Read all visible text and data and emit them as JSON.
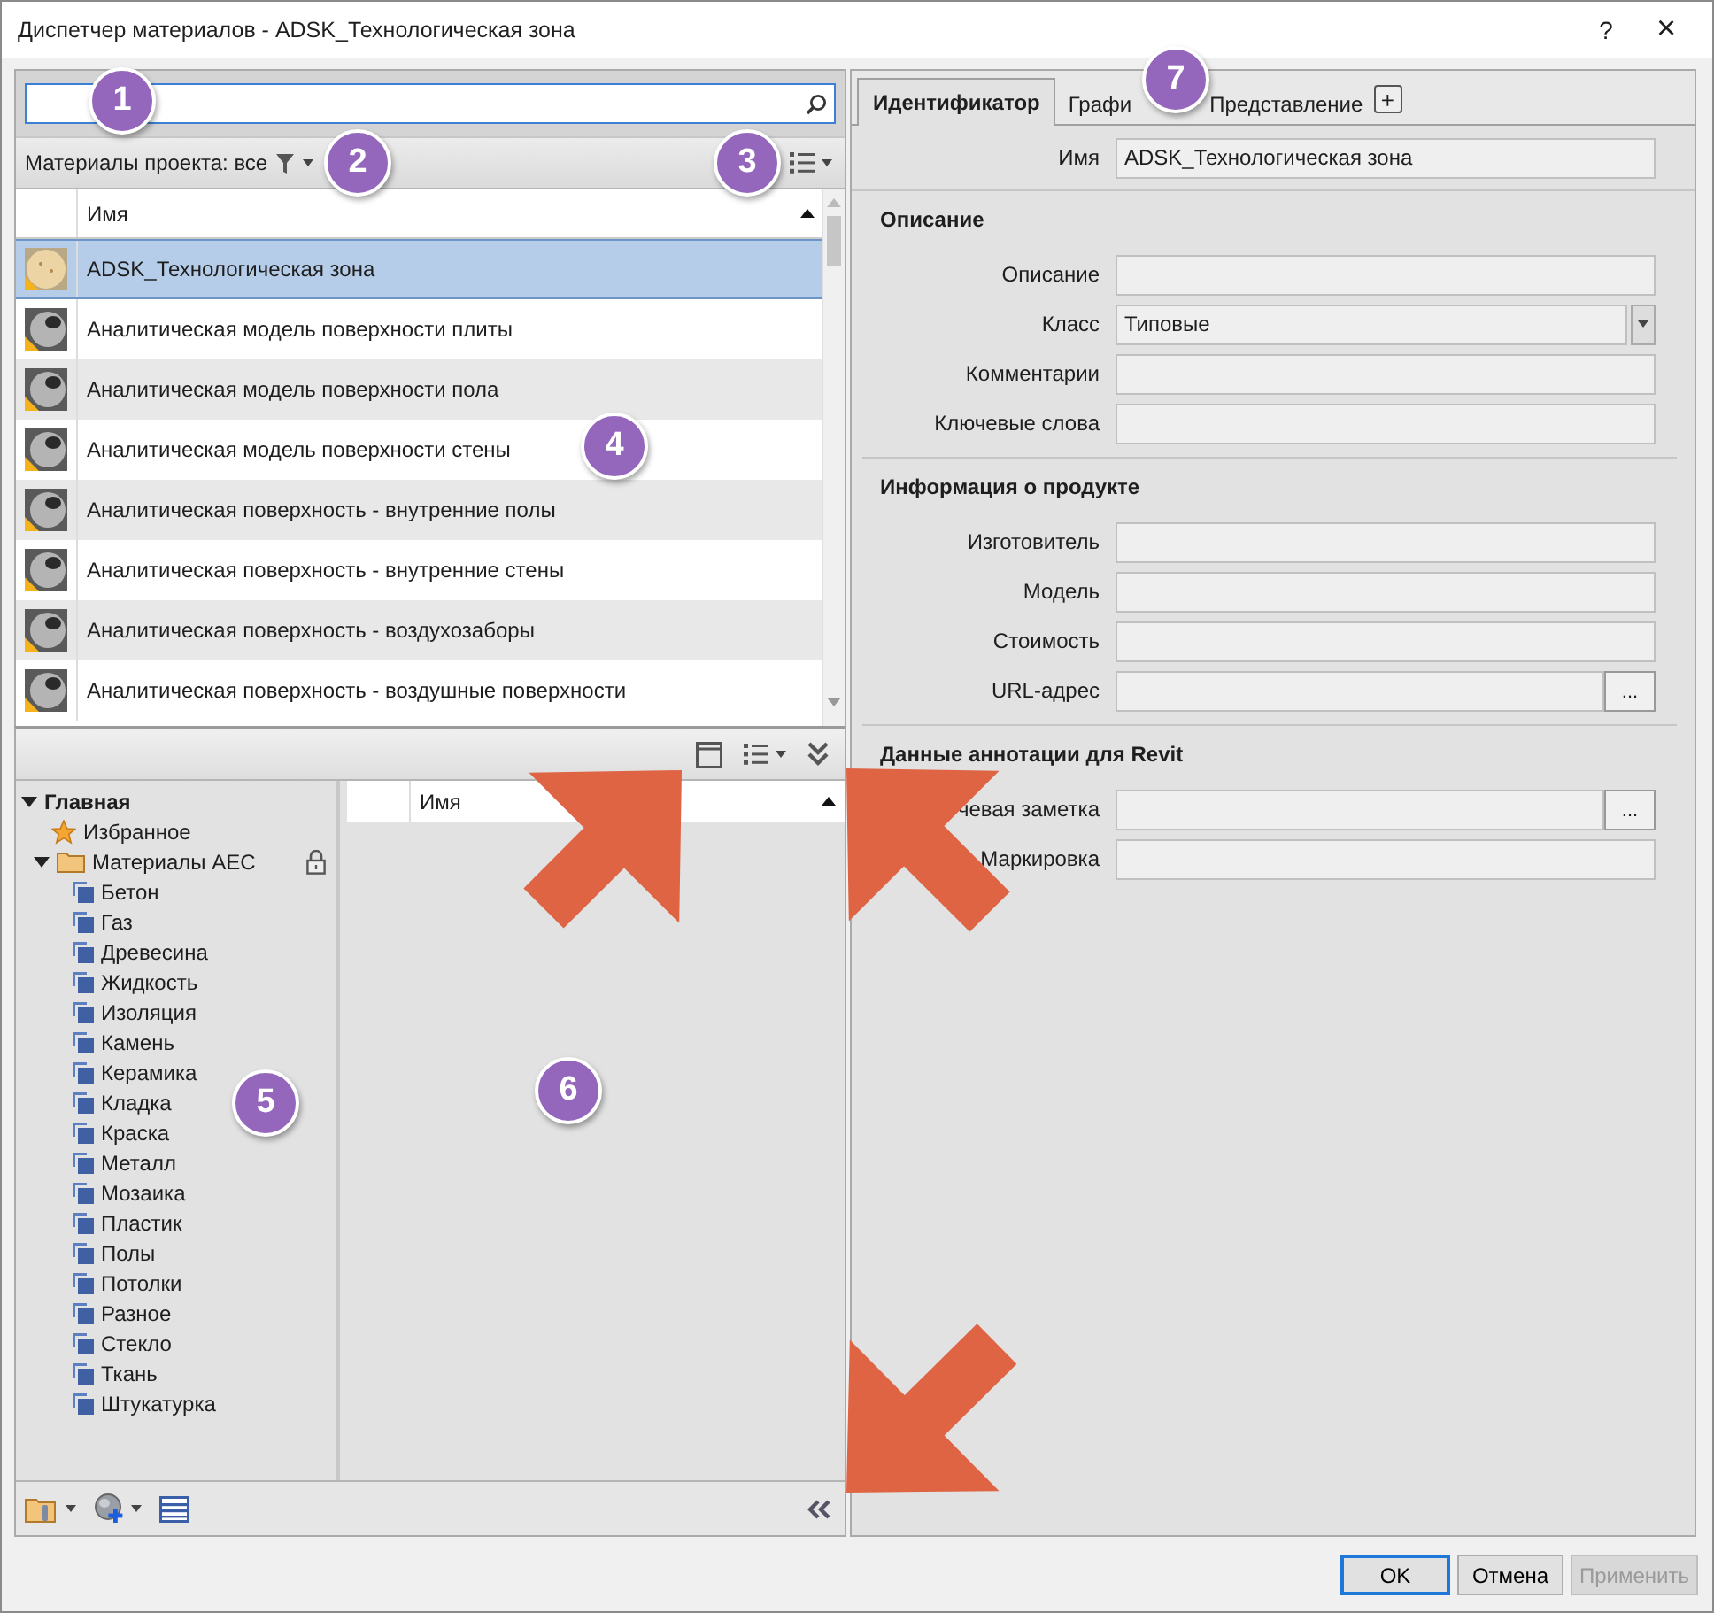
{
  "window": {
    "title": "Диспетчер материалов - ADSK_Технологическая зона",
    "help": "?",
    "close": "×"
  },
  "filter_bar": {
    "label": "Материалы проекта: все"
  },
  "materials": {
    "columns": [
      "Имя"
    ],
    "rows": [
      {
        "name": "ADSK_Технологическая зона",
        "kind": "sand",
        "selected": true
      },
      {
        "name": "Аналитическая модель поверхности плиты",
        "kind": "metal",
        "selected": false
      },
      {
        "name": "Аналитическая модель поверхности пола",
        "kind": "metal",
        "selected": false
      },
      {
        "name": "Аналитическая модель поверхности стены",
        "kind": "metal",
        "selected": false
      },
      {
        "name": "Аналитическая поверхность - внутренние полы",
        "kind": "metal",
        "selected": false
      },
      {
        "name": "Аналитическая поверхность - внутренние стены",
        "kind": "metal",
        "selected": false
      },
      {
        "name": "Аналитическая поверхность - воздухозаборы",
        "kind": "metal",
        "selected": false
      },
      {
        "name": "Аналитическая поверхность - воздушные поверхности",
        "kind": "metal",
        "selected": false
      }
    ]
  },
  "library": {
    "tree": [
      {
        "label": "Главная",
        "expanded": true,
        "children": [
          {
            "label": "Избранное",
            "kind": "favorites"
          },
          {
            "label": "Материалы AEC",
            "kind": "folder",
            "expanded": true,
            "locked": true,
            "children": [
              {
                "label": "Бетон",
                "kind": "category"
              },
              {
                "label": "Газ",
                "kind": "category"
              },
              {
                "label": "Древесина",
                "kind": "category"
              },
              {
                "label": "Жидкость",
                "kind": "category"
              },
              {
                "label": "Изоляция",
                "kind": "category"
              },
              {
                "label": "Камень",
                "kind": "category"
              },
              {
                "label": "Керамика",
                "kind": "category"
              },
              {
                "label": "Кладка",
                "kind": "category"
              },
              {
                "label": "Краска",
                "kind": "category"
              },
              {
                "label": "Металл",
                "kind": "category"
              },
              {
                "label": "Мозаика",
                "kind": "category"
              },
              {
                "label": "Пластик",
                "kind": "category"
              },
              {
                "label": "Полы",
                "kind": "category"
              },
              {
                "label": "Потолки",
                "kind": "category"
              },
              {
                "label": "Разное",
                "kind": "category"
              },
              {
                "label": "Стекло",
                "kind": "category"
              },
              {
                "label": "Ткань",
                "kind": "category"
              },
              {
                "label": "Штукатурка",
                "kind": "category"
              }
            ]
          }
        ]
      }
    ],
    "list_columns": [
      "Имя"
    ]
  },
  "properties": {
    "tabs": [
      {
        "label": "Идентификатор",
        "selected": true
      },
      {
        "label": "Графи",
        "selected": false
      },
      {
        "label": "Представление",
        "selected": false
      }
    ],
    "add_tab": "+",
    "name_field": {
      "label": "Имя",
      "value": "ADSK_Технологическая зона"
    },
    "sections": [
      {
        "title": "Описание",
        "fields": [
          {
            "label": "Описание",
            "kind": "text"
          },
          {
            "label": "Класс",
            "kind": "dropdown",
            "value": "Типовые"
          },
          {
            "label": "Комментарии",
            "kind": "text"
          },
          {
            "label": "Ключевые слова",
            "kind": "text"
          }
        ]
      },
      {
        "title": "Информация о продукте",
        "fields": [
          {
            "label": "Изготовитель",
            "kind": "text"
          },
          {
            "label": "Модель",
            "kind": "text"
          },
          {
            "label": "Стоимость",
            "kind": "text"
          },
          {
            "label": "URL-адрес",
            "kind": "browse",
            "button": "..."
          }
        ]
      },
      {
        "title": "Данные аннотации для Revit",
        "fields": [
          {
            "label": "чевая заметка",
            "kind": "browse",
            "button": "..."
          },
          {
            "label": "Маркировка",
            "kind": "text"
          }
        ]
      }
    ]
  },
  "buttons": [
    {
      "label": "OK",
      "default": true,
      "disabled": false
    },
    {
      "label": "Отмена",
      "default": false,
      "disabled": false
    },
    {
      "label": "Применить",
      "default": false,
      "disabled": true
    }
  ],
  "callouts": [
    "1",
    "2",
    "3",
    "4",
    "5",
    "6",
    "7"
  ]
}
